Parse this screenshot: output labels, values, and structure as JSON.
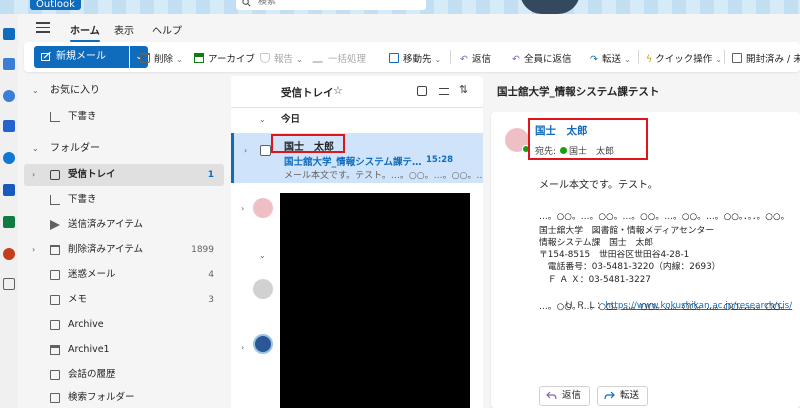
{
  "titlebar": {
    "app_name": "Outlook",
    "search_placeholder": "検索"
  },
  "ribbon": {
    "tabs": [
      "ホーム",
      "表示",
      "ヘルプ"
    ]
  },
  "toolbar": {
    "new_mail": "新規メール",
    "delete": "削除",
    "archive": "アーカイブ",
    "report": "報告",
    "sweep": "一括処理",
    "move": "移動先",
    "reply": "返信",
    "reply_all": "全員に返信",
    "forward": "転送",
    "quick_steps": "クイック操作",
    "read_unread": "開封済み / 未"
  },
  "folder_pane": {
    "favorites_header": "お気に入り",
    "favorites": [
      {
        "label": "下書き"
      }
    ],
    "folders_header": "フォルダー",
    "folders": [
      {
        "label": "受信トレイ",
        "count": "1"
      },
      {
        "label": "下書き",
        "count": ""
      },
      {
        "label": "送信済みアイテム",
        "count": ""
      },
      {
        "label": "削除済みアイテム",
        "count": "1899"
      },
      {
        "label": "迷惑メール",
        "count": "4"
      },
      {
        "label": "メモ",
        "count": "3"
      },
      {
        "label": "Archive",
        "count": ""
      },
      {
        "label": "Archive1",
        "count": ""
      },
      {
        "label": "会話の履歴",
        "count": ""
      },
      {
        "label": "検索フォルダー",
        "count": ""
      }
    ]
  },
  "message_list": {
    "title": "受信トレイ",
    "group_today": "今日",
    "selected": {
      "from": "国士　太郎",
      "subject": "国士舘大学_情報システム課テ…",
      "time": "15:28",
      "preview": "メール本文です。テスト。…。○○。…。○○。…"
    }
  },
  "reading_pane": {
    "subject": "国士舘大学_情報システム課テスト",
    "sender": "国士　太郎",
    "to_label": "宛先:",
    "to_name": "国士　太郎",
    "body": "メール本文です。テスト。",
    "signature": [
      "…。○○。…。○○。…。○○。…。○○。…。○○。．。．。○○。",
      "国士舘大学　図書館・情報メディアセンター",
      "情報システム課　国士　太郎",
      "〒154-8515　世田谷区世田谷4-28-1",
      "　電話番号：03-5481-3220（内線：2693）",
      "　Ｆ Ａ Ｘ：03-5481-3227",
      "　Ｕ Ｒ Ｌ：",
      "…。○○。…。○○。…。○○。…。○○。…。○○。．。．。○○。"
    ],
    "url": "https://www.kokushikan.ac.jp/research/cis/",
    "reply_button": "返信",
    "forward_button": "転送"
  }
}
